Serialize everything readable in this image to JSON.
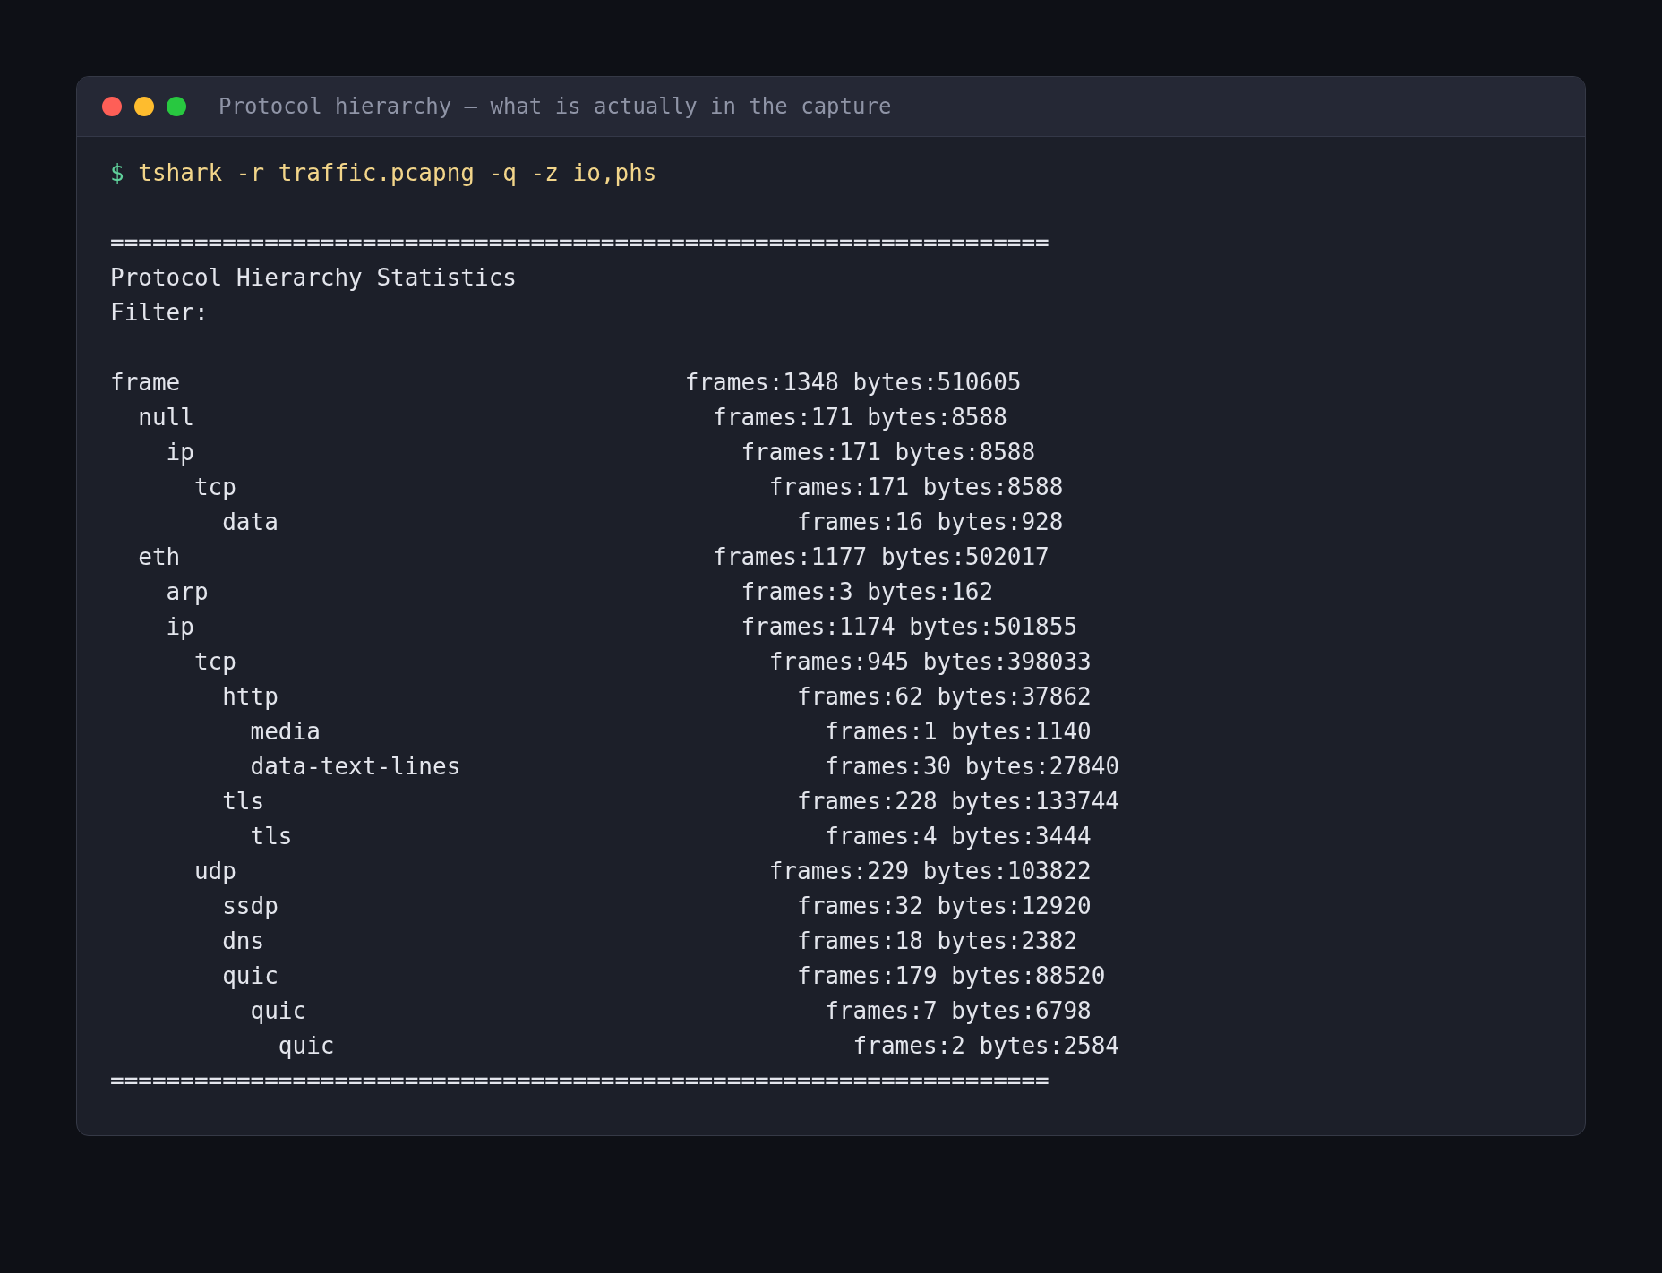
{
  "window": {
    "title": "Protocol hierarchy — what is actually in the capture"
  },
  "prompt": "$",
  "command": "tshark -r traffic.pcapng -q -z io,phs",
  "separator_top": "===================================================================",
  "heading": "Protocol Hierarchy Statistics",
  "filter_label": "Filter:",
  "tree": [
    {
      "name": "frame",
      "stats": "frames:1348 bytes:510605",
      "children": [
        {
          "name": "null",
          "stats": "frames:171 bytes:8588",
          "children": [
            {
              "name": "ip",
              "stats": "frames:171 bytes:8588",
              "children": [
                {
                  "name": "tcp",
                  "stats": "frames:171 bytes:8588",
                  "children": [
                    {
                      "name": "data",
                      "stats": "frames:16 bytes:928"
                    }
                  ]
                }
              ]
            }
          ]
        },
        {
          "name": "eth",
          "stats": "frames:1177 bytes:502017",
          "children": [
            {
              "name": "arp",
              "stats": "frames:3 bytes:162"
            },
            {
              "name": "ip",
              "stats": "frames:1174 bytes:501855",
              "children": [
                {
                  "name": "tcp",
                  "stats": "frames:945 bytes:398033",
                  "children": [
                    {
                      "name": "http",
                      "stats": "frames:62 bytes:37862",
                      "children": [
                        {
                          "name": "media",
                          "stats": "frames:1 bytes:1140"
                        },
                        {
                          "name": "data-text-lines",
                          "stats": "frames:30 bytes:27840"
                        }
                      ]
                    },
                    {
                      "name": "tls",
                      "stats": "frames:228 bytes:133744",
                      "children": [
                        {
                          "name": "tls",
                          "stats": "frames:4 bytes:3444"
                        }
                      ]
                    }
                  ]
                },
                {
                  "name": "udp",
                  "stats": "frames:229 bytes:103822",
                  "children": [
                    {
                      "name": "ssdp",
                      "stats": "frames:32 bytes:12920"
                    },
                    {
                      "name": "dns",
                      "stats": "frames:18 bytes:2382"
                    },
                    {
                      "name": "quic",
                      "stats": "frames:179 bytes:88520",
                      "children": [
                        {
                          "name": "quic",
                          "stats": "frames:7 bytes:6798",
                          "children": [
                            {
                              "name": "quic",
                              "stats": "frames:2 bytes:2584"
                            }
                          ]
                        }
                      ]
                    }
                  ]
                }
              ]
            }
          ]
        }
      ]
    }
  ],
  "separator_bottom": "==================================================================="
}
